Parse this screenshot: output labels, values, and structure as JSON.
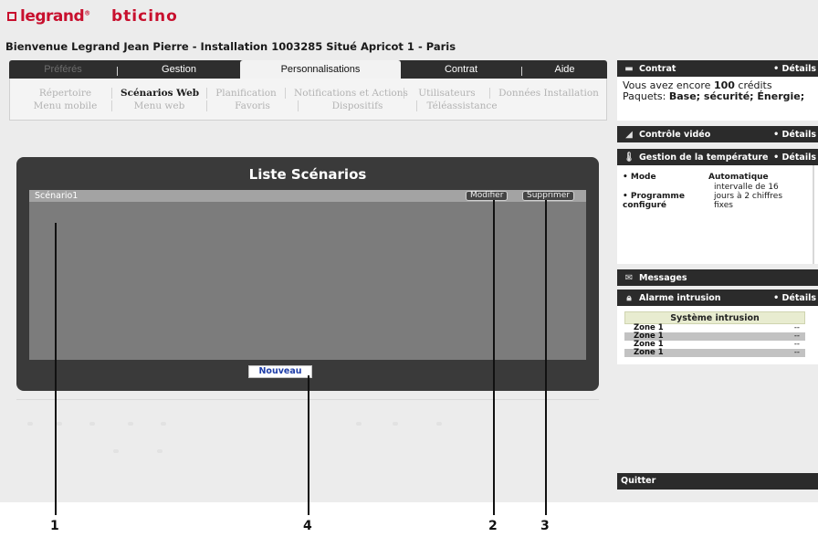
{
  "brand": {
    "legrand": "legrand",
    "legrand_mark": "®",
    "bticino": "bticino"
  },
  "welcome": "Bienvenue Legrand Jean Pierre - Installation 1003285 Situé Apricot 1 - Paris",
  "tabs": [
    {
      "label": "Préférés",
      "state": "muted"
    },
    {
      "label": "Gestion",
      "state": "normal"
    },
    {
      "label": "Personnalisations",
      "state": "active"
    },
    {
      "label": "Contrat",
      "state": "normal"
    },
    {
      "label": "Aide",
      "state": "normal"
    }
  ],
  "subnav": {
    "row1": [
      {
        "label": "Répertoire"
      },
      {
        "label": "Scénarios Web",
        "current": true
      },
      {
        "label": "Planification"
      },
      {
        "label": "Notifications et Actions"
      },
      {
        "label": "Utilisateurs"
      },
      {
        "label": "Données Installation"
      }
    ],
    "row2": [
      {
        "label": "Menu mobile"
      },
      {
        "label": "Menu web"
      },
      {
        "label": "Favoris"
      },
      {
        "label": "Dispositifs"
      },
      {
        "label": "Téléassistance"
      }
    ]
  },
  "panel": {
    "title": "Liste Scénarios",
    "scenario": "Scénario1",
    "modifier": "Modifier",
    "supprimer": "Supprimer",
    "nouveau": "Nouveau"
  },
  "sidebar": {
    "details": "• Détails",
    "contrat": {
      "title": "Contrat",
      "line1_pre": "Vous avez encore ",
      "credits": "100",
      "line1_post": " crédits",
      "line2_pre": "Paquets: ",
      "packages": "Base; sécurité; Énergie;"
    },
    "video": {
      "title": "Contrôle vidéo"
    },
    "temperature": {
      "title": "Gestion de la température",
      "mode_label": "• Mode",
      "mode_value": "Automatique",
      "prog_label_1": "• Programme",
      "prog_label_2": "configuré",
      "prog_value": "intervalle de 16 jours à 2 chiffres fixes"
    },
    "messages": {
      "title": "Messages"
    },
    "alarme": {
      "title": "Alarme intrusion",
      "system": "Système intrusion",
      "zones": [
        {
          "name": "Zone 1",
          "value": "--"
        },
        {
          "name": "Zone 1",
          "value": "--"
        },
        {
          "name": "Zone 1",
          "value": "--"
        },
        {
          "name": "Zone 1",
          "value": "--"
        }
      ]
    },
    "quitter": "Quitter"
  },
  "callouts": [
    "1",
    "4",
    "2",
    "3"
  ],
  "colors": {
    "brand_red": "#c8102e",
    "dark_bar": "#2b2b2b",
    "link_blue": "#1f3ea8"
  }
}
